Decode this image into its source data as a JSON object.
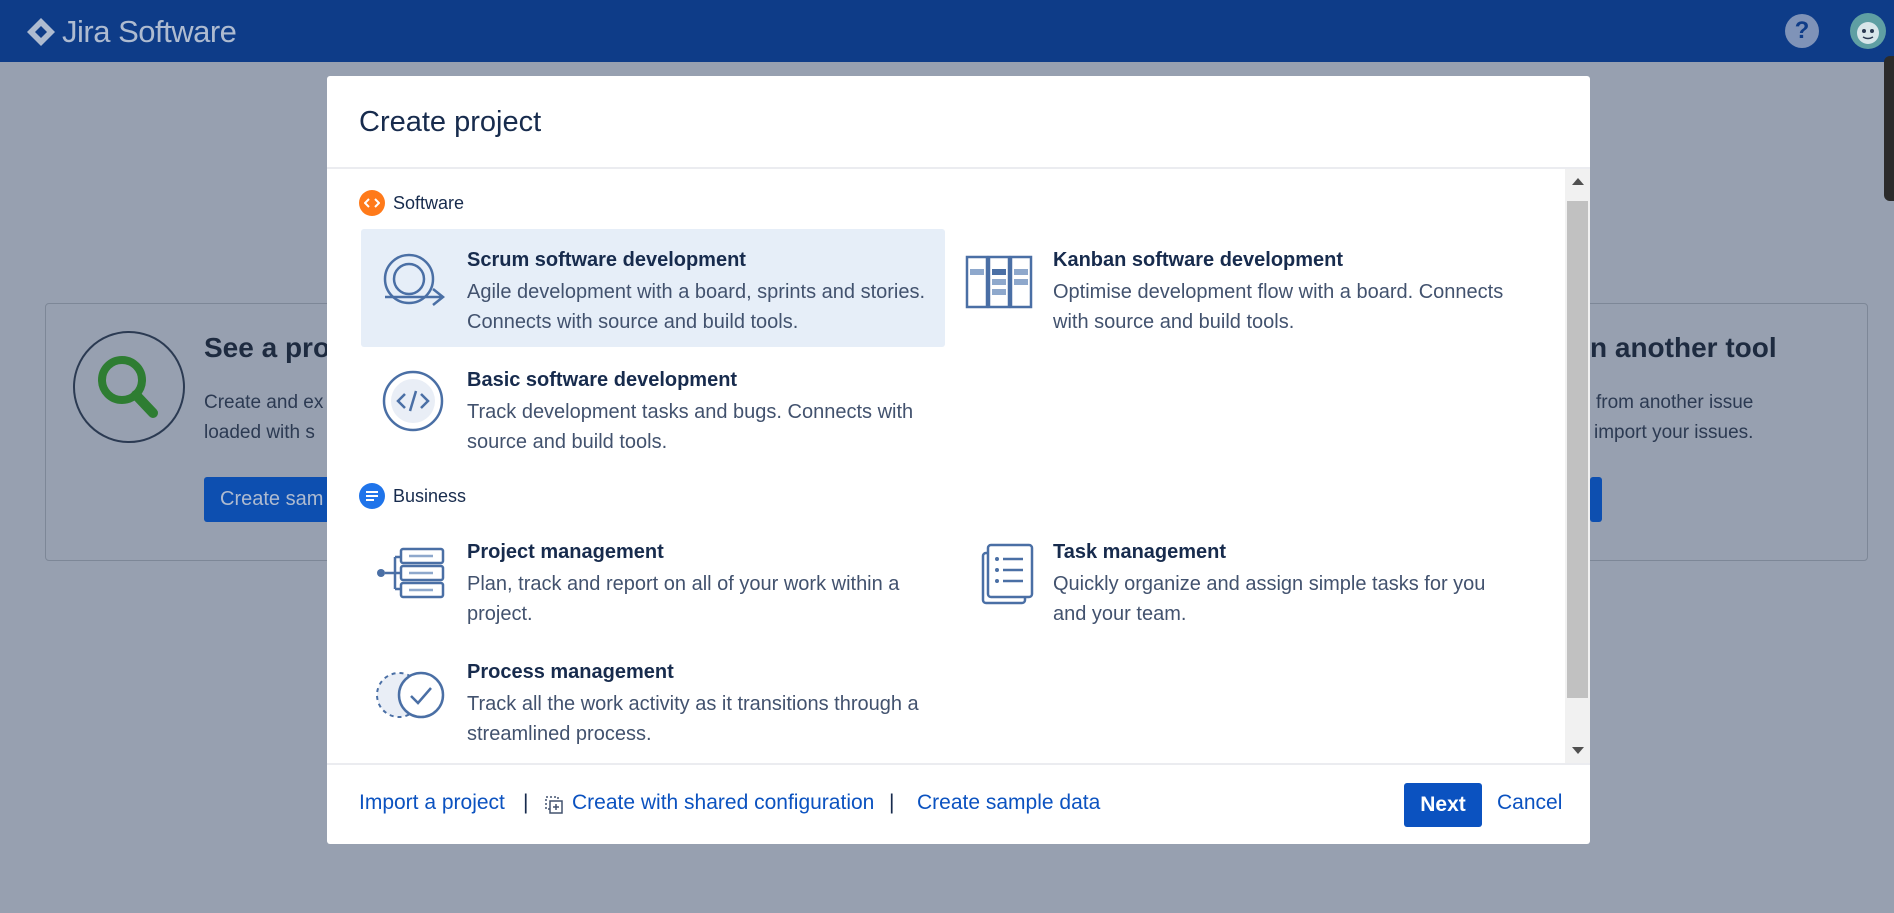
{
  "app": {
    "title": "Jira Software"
  },
  "topbar": {
    "help_label": "?"
  },
  "background": {
    "left_card": {
      "title": "See a pro",
      "text_line1": "Create and ex",
      "text_line2": "loaded with s",
      "button": "Create sam"
    },
    "right_card": {
      "title": "n another tool",
      "text_line1": "from another issue",
      "text_line2": "import your issues."
    }
  },
  "modal": {
    "title": "Create project",
    "sections": [
      {
        "label": "Software",
        "color": "#ff7a1a"
      },
      {
        "label": "Business",
        "color": "#1f74ea"
      }
    ],
    "options": [
      {
        "title": "Scrum software development",
        "desc": "Agile development with a board, sprints and stories. Connects with source and build tools.",
        "icon": "scrum-icon",
        "selected": true
      },
      {
        "title": "Kanban software development",
        "desc": "Optimise development flow with a board. Connects with source and build tools.",
        "icon": "kanban-icon",
        "selected": false
      },
      {
        "title": "Basic software development",
        "desc": "Track development tasks and bugs. Connects with source and build tools.",
        "icon": "code-icon",
        "selected": false
      },
      {
        "title": "Project management",
        "desc": "Plan, track and report on all of your work within a project.",
        "icon": "project-management-icon",
        "selected": false
      },
      {
        "title": "Task management",
        "desc": "Quickly organize and assign simple tasks for you and your team.",
        "icon": "task-list-icon",
        "selected": false
      },
      {
        "title": "Process management",
        "desc": "Track all the work activity as it transitions through a streamlined process.",
        "icon": "process-check-icon",
        "selected": false
      }
    ],
    "footer": {
      "import_link": "Import a project",
      "separator": "|",
      "shared_config_link": "Create with shared configuration",
      "sample_data_link": "Create sample data",
      "next_button": "Next",
      "cancel_link": "Cancel"
    }
  },
  "colors": {
    "topbar": "#0e3c88",
    "accent": "#0b52c0",
    "selected": "#e6eef8",
    "icon_stroke": "#4a6fa5"
  }
}
